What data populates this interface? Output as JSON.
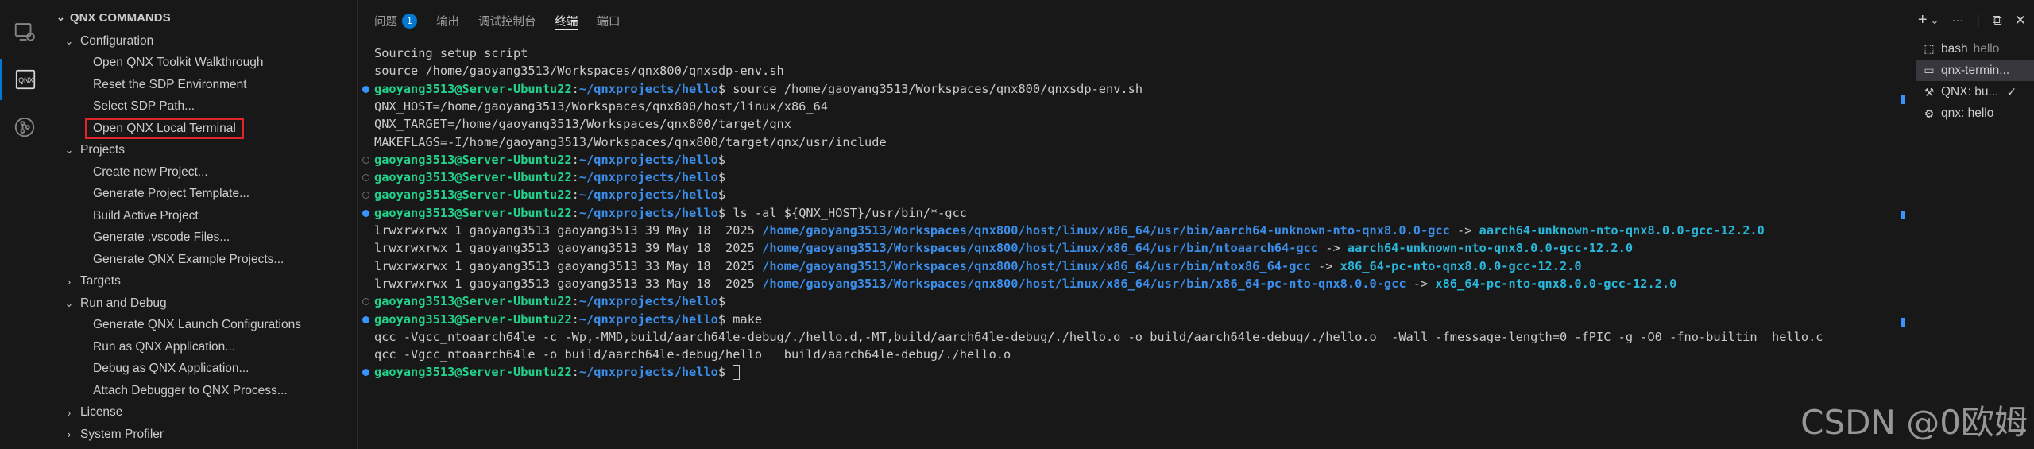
{
  "sidebar": {
    "title": "QNX COMMANDS",
    "rows": [
      {
        "label": "Configuration",
        "level": 1,
        "twisty": "⌄"
      },
      {
        "label": "Open QNX Toolkit Walkthrough",
        "level": 2
      },
      {
        "label": "Reset the SDP Environment",
        "level": 2
      },
      {
        "label": "Select SDP Path...",
        "level": 2
      },
      {
        "label": "Open QNX Local Terminal",
        "level": 2,
        "highlight": true
      },
      {
        "label": "Projects",
        "level": 1,
        "twisty": "⌄"
      },
      {
        "label": "Create new Project...",
        "level": 2
      },
      {
        "label": "Generate Project Template...",
        "level": 2
      },
      {
        "label": "Build Active Project",
        "level": 2
      },
      {
        "label": "Generate .vscode Files...",
        "level": 2
      },
      {
        "label": "Generate QNX Example Projects...",
        "level": 2
      },
      {
        "label": "Targets",
        "level": 1,
        "twisty": "›"
      },
      {
        "label": "Run and Debug",
        "level": 1,
        "twisty": "⌄"
      },
      {
        "label": "Generate QNX Launch Configurations",
        "level": 2
      },
      {
        "label": "Run as QNX Application...",
        "level": 2
      },
      {
        "label": "Debug as QNX Application...",
        "level": 2
      },
      {
        "label": "Attach Debugger to QNX Process...",
        "level": 2
      },
      {
        "label": "License",
        "level": 1,
        "twisty": "›"
      },
      {
        "label": "System Profiler",
        "level": 1,
        "twisty": "›"
      }
    ]
  },
  "panel": {
    "tabs": [
      {
        "label": "问题",
        "badge": "1"
      },
      {
        "label": "输出"
      },
      {
        "label": "调试控制台"
      },
      {
        "label": "终端",
        "active": true
      },
      {
        "label": "端口"
      }
    ],
    "tools": {
      "add": "+",
      "dropdown": "⌄",
      "more": "···",
      "maximize": "⧉",
      "close": "✕"
    }
  },
  "terminal": {
    "prompt_user": "gaoyang3513@Server-Ubuntu22",
    "prompt_path": "~/qnxprojects/hello",
    "lines": [
      {
        "type": "text",
        "text": "Sourcing setup script"
      },
      {
        "type": "text",
        "text": "source /home/gaoyang3513/Workspaces/qnx800/qnxsdp-env.sh"
      },
      {
        "type": "prompt",
        "dot": "blue",
        "cmd": " source /home/gaoyang3513/Workspaces/qnx800/qnxsdp-env.sh"
      },
      {
        "type": "text",
        "text": "QNX_HOST=/home/gaoyang3513/Workspaces/qnx800/host/linux/x86_64"
      },
      {
        "type": "text",
        "text": "QNX_TARGET=/home/gaoyang3513/Workspaces/qnx800/target/qnx"
      },
      {
        "type": "text",
        "text": "MAKEFLAGS=-I/home/gaoyang3513/Workspaces/qnx800/target/qnx/usr/include"
      },
      {
        "type": "prompt",
        "dot": "hollow",
        "cmd": ""
      },
      {
        "type": "prompt",
        "dot": "hollow",
        "cmd": ""
      },
      {
        "type": "prompt",
        "dot": "hollow",
        "cmd": ""
      },
      {
        "type": "prompt",
        "dot": "blue",
        "cmd": " ls -al ${QNX_HOST}/usr/bin/*-gcc"
      },
      {
        "type": "ls",
        "meta": "lrwxrwxrwx 1 gaoyang3513 gaoyang3513 39 May 18  2025 ",
        "path": "/home/gaoyang3513/Workspaces/qnx800/host/linux/x86_64/usr/bin/aarch64-unknown-nto-qnx8.0.0-gcc",
        "arrow": " -> ",
        "target": "aarch64-unknown-nto-qnx8.0.0-gcc-12.2.0"
      },
      {
        "type": "ls",
        "meta": "lrwxrwxrwx 1 gaoyang3513 gaoyang3513 39 May 18  2025 ",
        "path": "/home/gaoyang3513/Workspaces/qnx800/host/linux/x86_64/usr/bin/ntoaarch64-gcc",
        "arrow": " -> ",
        "target": "aarch64-unknown-nto-qnx8.0.0-gcc-12.2.0"
      },
      {
        "type": "ls",
        "meta": "lrwxrwxrwx 1 gaoyang3513 gaoyang3513 33 May 18  2025 ",
        "path": "/home/gaoyang3513/Workspaces/qnx800/host/linux/x86_64/usr/bin/ntox86_64-gcc",
        "arrow": " -> ",
        "target": "x86_64-pc-nto-qnx8.0.0-gcc-12.2.0"
      },
      {
        "type": "ls",
        "meta": "lrwxrwxrwx 1 gaoyang3513 gaoyang3513 33 May 18  2025 ",
        "path": "/home/gaoyang3513/Workspaces/qnx800/host/linux/x86_64/usr/bin/x86_64-pc-nto-qnx8.0.0-gcc",
        "arrow": " -> ",
        "target": "x86_64-pc-nto-qnx8.0.0-gcc-12.2.0"
      },
      {
        "type": "prompt",
        "dot": "hollow",
        "cmd": ""
      },
      {
        "type": "prompt",
        "dot": "blue",
        "cmd": " make"
      },
      {
        "type": "text",
        "text": "qcc -Vgcc_ntoaarch64le -c -Wp,-MMD,build/aarch64le-debug/./hello.d,-MT,build/aarch64le-debug/./hello.o -o build/aarch64le-debug/./hello.o  -Wall -fmessage-length=0 -fPIC -g -O0 -fno-builtin  hello.c"
      },
      {
        "type": "text",
        "text": "qcc -Vgcc_ntoaarch64le -o build/aarch64le-debug/hello   build/aarch64le-debug/./hello.o"
      },
      {
        "type": "prompt",
        "dot": "blue",
        "cmd": " ",
        "cursor": true
      }
    ]
  },
  "terminal_list": [
    {
      "icon": "bash-icon",
      "glyph": "⬚",
      "name": "bash",
      "sub": "hello"
    },
    {
      "icon": "terminal-icon",
      "glyph": "▭",
      "name": "qnx-termin...",
      "active": true
    },
    {
      "icon": "tools-icon",
      "glyph": "⚒",
      "name": "QNX: bu...",
      "check": "✓"
    },
    {
      "icon": "debug-icon",
      "glyph": "⚙",
      "name": "qnx: hello"
    }
  ],
  "watermark": "CSDN @0欧姆",
  "colors": {
    "accent": "#0078d4",
    "prompt_user": "#23d18b",
    "prompt_path": "#3b8eea",
    "ls_target": "#29b8db",
    "highlight_border": "#e0262d"
  }
}
